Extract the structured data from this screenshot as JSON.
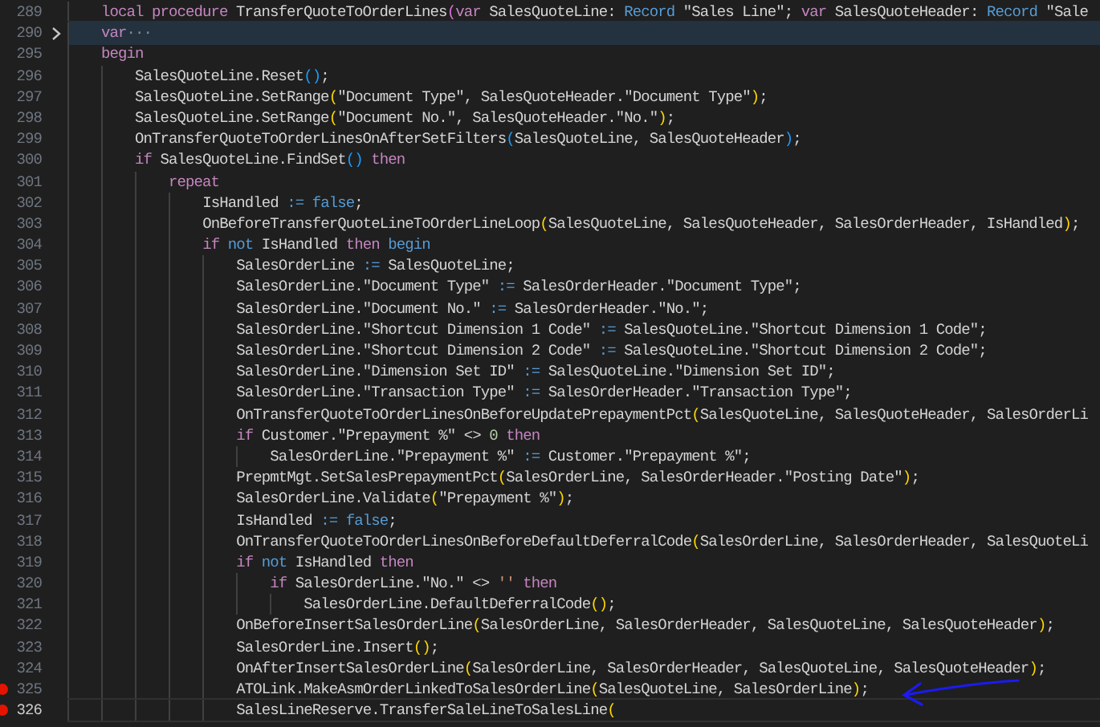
{
  "editor": {
    "lines": [
      {
        "number": "289",
        "breakpoint": false,
        "folded": false,
        "current": false,
        "tokens": [
          {
            "kind": "kw",
            "text": "    local procedure"
          },
          {
            "kind": "plain",
            "text": " TransferQuoteToOrderLines"
          },
          {
            "kind": "b2",
            "text": "("
          },
          {
            "kind": "kw",
            "text": "var"
          },
          {
            "kind": "plain",
            "text": " SalesQuoteLine: "
          },
          {
            "kind": "kw2",
            "text": "Record"
          },
          {
            "kind": "plain",
            "text": " \"Sales Line\"; "
          },
          {
            "kind": "kw",
            "text": "var"
          },
          {
            "kind": "plain",
            "text": " SalesQuoteHeader: "
          },
          {
            "kind": "kw2",
            "text": "Record"
          },
          {
            "kind": "plain",
            "text": " \"Sale"
          }
        ]
      },
      {
        "number": "290",
        "breakpoint": false,
        "folded": true,
        "current": false,
        "tokens": [
          {
            "kind": "kw",
            "text": "    var"
          },
          {
            "kind": "fold",
            "text": "···"
          }
        ]
      },
      {
        "number": "295",
        "breakpoint": false,
        "folded": false,
        "current": false,
        "tokens": [
          {
            "kind": "kw",
            "text": "    begin"
          }
        ]
      },
      {
        "number": "296",
        "breakpoint": false,
        "folded": false,
        "current": false,
        "tokens": [
          {
            "kind": "plain",
            "text": "        SalesQuoteLine.Reset"
          },
          {
            "kind": "b3",
            "text": "()"
          },
          {
            "kind": "plain",
            "text": ";"
          }
        ]
      },
      {
        "number": "297",
        "breakpoint": false,
        "folded": false,
        "current": false,
        "tokens": [
          {
            "kind": "plain",
            "text": "        SalesQuoteLine.SetRange"
          },
          {
            "kind": "b1",
            "text": "("
          },
          {
            "kind": "plain",
            "text": "\"Document Type\", SalesQuoteHeader.\"Document Type\""
          },
          {
            "kind": "b1",
            "text": ")"
          },
          {
            "kind": "plain",
            "text": ";"
          }
        ]
      },
      {
        "number": "298",
        "breakpoint": false,
        "folded": false,
        "current": false,
        "tokens": [
          {
            "kind": "plain",
            "text": "        SalesQuoteLine.SetRange"
          },
          {
            "kind": "b1",
            "text": "("
          },
          {
            "kind": "plain",
            "text": "\"Document No.\", SalesQuoteHeader.\"No.\""
          },
          {
            "kind": "b1",
            "text": ")"
          },
          {
            "kind": "plain",
            "text": ";"
          }
        ]
      },
      {
        "number": "299",
        "breakpoint": false,
        "folded": false,
        "current": false,
        "tokens": [
          {
            "kind": "plain",
            "text": "        OnTransferQuoteToOrderLinesOnAfterSetFilters"
          },
          {
            "kind": "b3",
            "text": "("
          },
          {
            "kind": "plain",
            "text": "SalesQuoteLine, SalesQuoteHeader"
          },
          {
            "kind": "b3",
            "text": ")"
          },
          {
            "kind": "plain",
            "text": ";"
          }
        ]
      },
      {
        "number": "300",
        "breakpoint": false,
        "folded": false,
        "current": false,
        "tokens": [
          {
            "kind": "kw",
            "text": "        if"
          },
          {
            "kind": "plain",
            "text": " SalesQuoteLine.FindSet"
          },
          {
            "kind": "b3",
            "text": "() "
          },
          {
            "kind": "kw",
            "text": "then"
          }
        ]
      },
      {
        "number": "301",
        "breakpoint": false,
        "folded": false,
        "current": false,
        "tokens": [
          {
            "kind": "kw",
            "text": "            repeat"
          }
        ]
      },
      {
        "number": "302",
        "breakpoint": false,
        "folded": false,
        "current": false,
        "tokens": [
          {
            "kind": "plain",
            "text": "                IsHandled "
          },
          {
            "kind": "kw2",
            "text": ":= false"
          },
          {
            "kind": "plain",
            "text": ";"
          }
        ]
      },
      {
        "number": "303",
        "breakpoint": false,
        "folded": false,
        "current": false,
        "tokens": [
          {
            "kind": "plain",
            "text": "                OnBeforeTransferQuoteLineToOrderLineLoop"
          },
          {
            "kind": "b1",
            "text": "("
          },
          {
            "kind": "plain",
            "text": "SalesQuoteLine, SalesQuoteHeader, SalesOrderHeader, IsHandled"
          },
          {
            "kind": "b1",
            "text": ")"
          },
          {
            "kind": "plain",
            "text": ";"
          }
        ]
      },
      {
        "number": "304",
        "breakpoint": false,
        "folded": false,
        "current": false,
        "tokens": [
          {
            "kind": "kw",
            "text": "                if "
          },
          {
            "kind": "kw2",
            "text": "not"
          },
          {
            "kind": "plain",
            "text": " IsHandled "
          },
          {
            "kind": "kw",
            "text": "then "
          },
          {
            "kind": "kw2",
            "text": "begin"
          }
        ]
      },
      {
        "number": "305",
        "breakpoint": false,
        "folded": false,
        "current": false,
        "tokens": [
          {
            "kind": "plain",
            "text": "                    SalesOrderLine "
          },
          {
            "kind": "kw2",
            "text": ":="
          },
          {
            "kind": "plain",
            "text": " SalesQuoteLine;"
          }
        ]
      },
      {
        "number": "306",
        "breakpoint": false,
        "folded": false,
        "current": false,
        "tokens": [
          {
            "kind": "plain",
            "text": "                    SalesOrderLine.\"Document Type\" "
          },
          {
            "kind": "kw2",
            "text": ":="
          },
          {
            "kind": "plain",
            "text": " SalesOrderHeader.\"Document Type\";"
          }
        ]
      },
      {
        "number": "307",
        "breakpoint": false,
        "folded": false,
        "current": false,
        "tokens": [
          {
            "kind": "plain",
            "text": "                    SalesOrderLine.\"Document No.\" "
          },
          {
            "kind": "kw2",
            "text": ":="
          },
          {
            "kind": "plain",
            "text": " SalesOrderHeader.\"No.\";"
          }
        ]
      },
      {
        "number": "308",
        "breakpoint": false,
        "folded": false,
        "current": false,
        "tokens": [
          {
            "kind": "plain",
            "text": "                    SalesOrderLine.\"Shortcut Dimension 1 Code\" "
          },
          {
            "kind": "kw2",
            "text": ":="
          },
          {
            "kind": "plain",
            "text": " SalesQuoteLine.\"Shortcut Dimension 1 Code\";"
          }
        ]
      },
      {
        "number": "309",
        "breakpoint": false,
        "folded": false,
        "current": false,
        "tokens": [
          {
            "kind": "plain",
            "text": "                    SalesOrderLine.\"Shortcut Dimension 2 Code\" "
          },
          {
            "kind": "kw2",
            "text": ":="
          },
          {
            "kind": "plain",
            "text": " SalesQuoteLine.\"Shortcut Dimension 2 Code\";"
          }
        ]
      },
      {
        "number": "310",
        "breakpoint": false,
        "folded": false,
        "current": false,
        "tokens": [
          {
            "kind": "plain",
            "text": "                    SalesOrderLine.\"Dimension Set ID\" "
          },
          {
            "kind": "kw2",
            "text": ":="
          },
          {
            "kind": "plain",
            "text": " SalesQuoteLine.\"Dimension Set ID\";"
          }
        ]
      },
      {
        "number": "311",
        "breakpoint": false,
        "folded": false,
        "current": false,
        "tokens": [
          {
            "kind": "plain",
            "text": "                    SalesOrderLine.\"Transaction Type\" "
          },
          {
            "kind": "kw2",
            "text": ":="
          },
          {
            "kind": "plain",
            "text": " SalesOrderHeader.\"Transaction Type\";"
          }
        ]
      },
      {
        "number": "312",
        "breakpoint": false,
        "folded": false,
        "current": false,
        "tokens": [
          {
            "kind": "plain",
            "text": "                    OnTransferQuoteToOrderLinesOnBeforeUpdatePrepaymentPct"
          },
          {
            "kind": "b1",
            "text": "("
          },
          {
            "kind": "plain",
            "text": "SalesQuoteLine, SalesQuoteHeader, SalesOrderLi"
          }
        ]
      },
      {
        "number": "313",
        "breakpoint": false,
        "folded": false,
        "current": false,
        "tokens": [
          {
            "kind": "kw",
            "text": "                    if"
          },
          {
            "kind": "plain",
            "text": " Customer.\"Prepayment %\" <> "
          },
          {
            "kind": "num",
            "text": "0 "
          },
          {
            "kind": "kw",
            "text": "then"
          }
        ]
      },
      {
        "number": "314",
        "breakpoint": false,
        "folded": false,
        "current": false,
        "tokens": [
          {
            "kind": "plain",
            "text": "                        SalesOrderLine.\"Prepayment %\" "
          },
          {
            "kind": "kw2",
            "text": ":="
          },
          {
            "kind": "plain",
            "text": " Customer.\"Prepayment %\";"
          }
        ]
      },
      {
        "number": "315",
        "breakpoint": false,
        "folded": false,
        "current": false,
        "tokens": [
          {
            "kind": "plain",
            "text": "                    PrepmtMgt.SetSalesPrepaymentPct"
          },
          {
            "kind": "b1",
            "text": "("
          },
          {
            "kind": "plain",
            "text": "SalesOrderLine, SalesOrderHeader.\"Posting Date\""
          },
          {
            "kind": "b1",
            "text": ")"
          },
          {
            "kind": "plain",
            "text": ";"
          }
        ]
      },
      {
        "number": "316",
        "breakpoint": false,
        "folded": false,
        "current": false,
        "tokens": [
          {
            "kind": "plain",
            "text": "                    SalesOrderLine.Validate"
          },
          {
            "kind": "b1",
            "text": "("
          },
          {
            "kind": "plain",
            "text": "\"Prepayment %\""
          },
          {
            "kind": "b1",
            "text": ")"
          },
          {
            "kind": "plain",
            "text": ";"
          }
        ]
      },
      {
        "number": "317",
        "breakpoint": false,
        "folded": false,
        "current": false,
        "tokens": [
          {
            "kind": "plain",
            "text": "                    IsHandled "
          },
          {
            "kind": "kw2",
            "text": ":= false"
          },
          {
            "kind": "plain",
            "text": ";"
          }
        ]
      },
      {
        "number": "318",
        "breakpoint": false,
        "folded": false,
        "current": false,
        "tokens": [
          {
            "kind": "plain",
            "text": "                    OnTransferQuoteToOrderLinesOnBeforeDefaultDeferralCode"
          },
          {
            "kind": "b1",
            "text": "("
          },
          {
            "kind": "plain",
            "text": "SalesOrderLine, SalesOrderHeader, SalesQuoteLi"
          }
        ]
      },
      {
        "number": "319",
        "breakpoint": false,
        "folded": false,
        "current": false,
        "tokens": [
          {
            "kind": "kw",
            "text": "                    if "
          },
          {
            "kind": "kw2",
            "text": "not"
          },
          {
            "kind": "plain",
            "text": " IsHandled "
          },
          {
            "kind": "kw",
            "text": "then"
          }
        ]
      },
      {
        "number": "320",
        "breakpoint": false,
        "folded": false,
        "current": false,
        "tokens": [
          {
            "kind": "kw",
            "text": "                        if"
          },
          {
            "kind": "plain",
            "text": " SalesOrderLine.\"No.\" <> "
          },
          {
            "kind": "str",
            "text": "'' "
          },
          {
            "kind": "kw",
            "text": "then"
          }
        ]
      },
      {
        "number": "321",
        "breakpoint": false,
        "folded": false,
        "current": false,
        "tokens": [
          {
            "kind": "plain",
            "text": "                            SalesOrderLine.DefaultDeferralCode"
          },
          {
            "kind": "b1",
            "text": "()"
          },
          {
            "kind": "plain",
            "text": ";"
          }
        ]
      },
      {
        "number": "322",
        "breakpoint": false,
        "folded": false,
        "current": false,
        "tokens": [
          {
            "kind": "plain",
            "text": "                    OnBeforeInsertSalesOrderLine"
          },
          {
            "kind": "b1",
            "text": "("
          },
          {
            "kind": "plain",
            "text": "SalesOrderLine, SalesOrderHeader, SalesQuoteLine, SalesQuoteHeader"
          },
          {
            "kind": "b1",
            "text": ")"
          },
          {
            "kind": "plain",
            "text": ";"
          }
        ]
      },
      {
        "number": "323",
        "breakpoint": false,
        "folded": false,
        "current": false,
        "tokens": [
          {
            "kind": "plain",
            "text": "                    SalesOrderLine.Insert"
          },
          {
            "kind": "b1",
            "text": "()"
          },
          {
            "kind": "plain",
            "text": ";"
          }
        ]
      },
      {
        "number": "324",
        "breakpoint": false,
        "folded": false,
        "current": false,
        "tokens": [
          {
            "kind": "plain",
            "text": "                    OnAfterInsertSalesOrderLine"
          },
          {
            "kind": "b1",
            "text": "("
          },
          {
            "kind": "plain",
            "text": "SalesOrderLine, SalesOrderHeader, SalesQuoteLine, SalesQuoteHeader"
          },
          {
            "kind": "b1",
            "text": ")"
          },
          {
            "kind": "plain",
            "text": ";"
          }
        ]
      },
      {
        "number": "325",
        "breakpoint": true,
        "folded": false,
        "current": false,
        "tokens": [
          {
            "kind": "plain",
            "text": "                    ATOLink.MakeAsmOrderLinkedToSalesOrderLine"
          },
          {
            "kind": "b1",
            "text": "("
          },
          {
            "kind": "plain",
            "text": "SalesQuoteLine, SalesOrderLine"
          },
          {
            "kind": "b1",
            "text": ")"
          },
          {
            "kind": "plain",
            "text": ";"
          }
        ]
      },
      {
        "number": "326",
        "breakpoint": true,
        "folded": false,
        "current": true,
        "tokens": [
          {
            "kind": "plain",
            "text": "                    SalesLineReserve.TransferSaleLineToSalesLine"
          },
          {
            "kind": "b1",
            "text": "("
          }
        ]
      }
    ]
  }
}
